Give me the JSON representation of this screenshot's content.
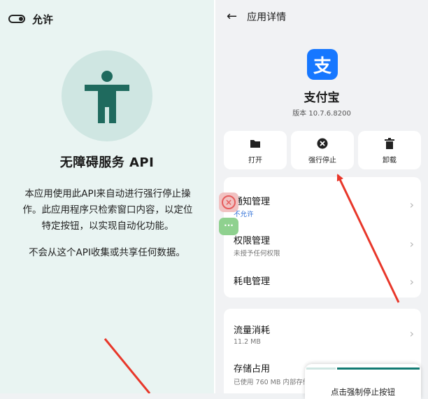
{
  "left": {
    "title": "允许",
    "service_title": "无障碍服务 API",
    "description": "本应用使用此API来自动进行强行停止操作。此应用程序只检索窗口内容，以定位特定按钮，以实现自动化功能。",
    "note": "不会从这个API收集或共享任何数据。",
    "accent_color": "#1f6a5e"
  },
  "right": {
    "title": "应用详情",
    "app": {
      "icon_glyph": "支",
      "name": "支付宝",
      "version": "版本 10.7.6.8200",
      "brand_color": "#1677ff"
    },
    "actions": [
      {
        "label": "打开",
        "icon": "folder-icon"
      },
      {
        "label": "强行停止",
        "icon": "close-circle-icon"
      },
      {
        "label": "卸载",
        "icon": "trash-icon"
      }
    ],
    "settings": [
      {
        "title": "通知管理",
        "subtitle": "不允许"
      },
      {
        "title": "权限管理",
        "subtitle": "未授予任何权限"
      },
      {
        "title": "耗电管理",
        "subtitle": ""
      }
    ],
    "storage": [
      {
        "title": "流量消耗",
        "subtitle": "11.2 MB"
      },
      {
        "title": "存储占用",
        "subtitle": "已使用 760 MB 内部存储"
      }
    ],
    "floating": {
      "more_glyph": "···"
    },
    "popup": {
      "text": "点击强制停止按钮",
      "progress": 0.75
    },
    "annotation_color": "#e8372a"
  }
}
